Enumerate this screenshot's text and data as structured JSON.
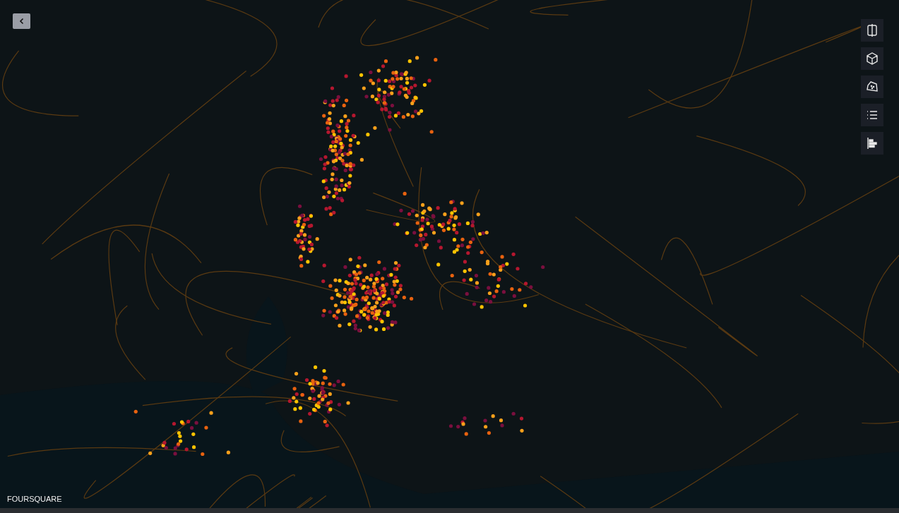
{
  "map_controls": [
    {
      "kind": "split"
    },
    {
      "kind": "cube"
    },
    {
      "kind": "draw"
    },
    {
      "kind": "legend"
    },
    {
      "kind": "layers"
    }
  ],
  "attribution": "FOURSQUARE"
}
